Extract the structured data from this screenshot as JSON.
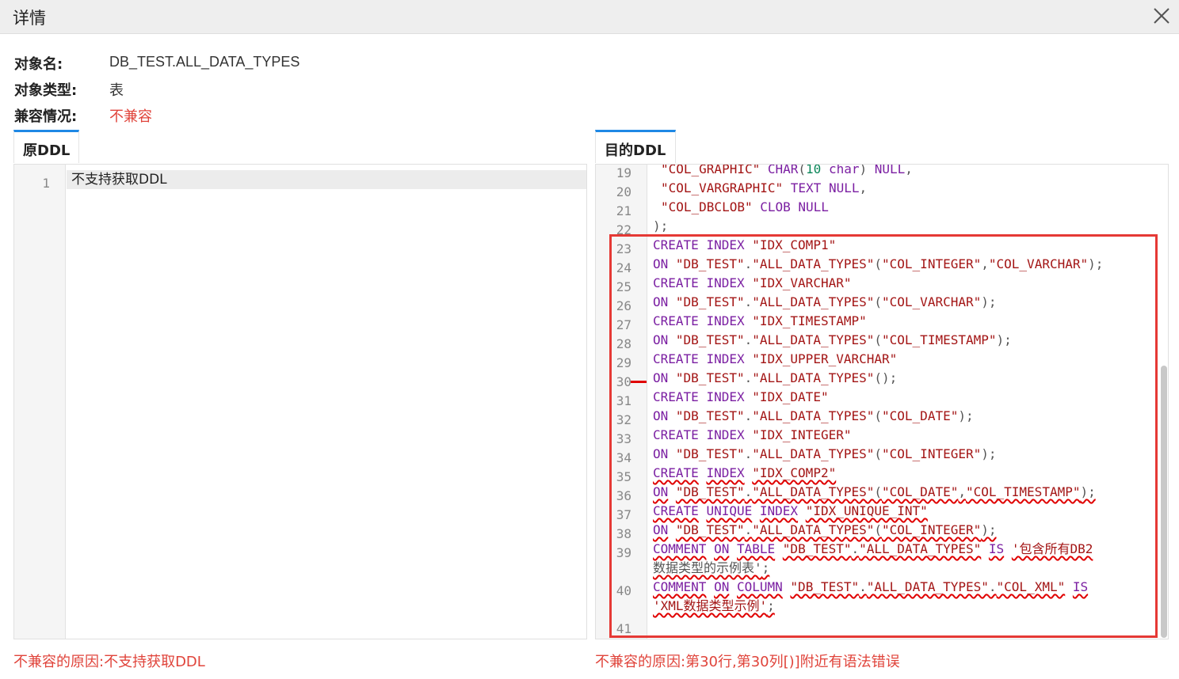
{
  "dialog": {
    "title": "详情"
  },
  "info": {
    "object_name_label": "对象名:",
    "object_name_value": "DB_TEST.ALL_DATA_TYPES",
    "object_type_label": "对象类型:",
    "object_type_value": "表",
    "compat_label": "兼容情况:",
    "compat_value": "不兼容"
  },
  "source_panel": {
    "tab_label": "原DDL",
    "lines": [
      {
        "num": "1",
        "text": "不支持获取DDL"
      }
    ],
    "error_message": "不兼容的原因:不支持获取DDL"
  },
  "target_panel": {
    "tab_label": "目的DDL",
    "line_numbers": [
      "19",
      "20",
      "21",
      "22",
      "23",
      "24",
      "25",
      "26",
      "27",
      "28",
      "29",
      "30",
      "31",
      "32",
      "33",
      "34",
      "35",
      "36",
      "37",
      "38",
      "39",
      "",
      "40",
      "",
      "41"
    ],
    "error_message": "不兼容的原因:第30行,第30列[)]附近有语法错误",
    "code": {
      "l19": [
        "\"COL_GRAPHIC\"",
        "CHAR",
        "(",
        "10",
        "char",
        ")",
        "NULL",
        ","
      ],
      "l20": [
        "\"COL_VARGRAPHIC\"",
        "TEXT",
        "NULL",
        ","
      ],
      "l21": [
        "\"COL_DBCLOB\"",
        "CLOB",
        "NULL"
      ],
      "l22": [
        ");"
      ],
      "l23": [
        "CREATE",
        "INDEX",
        "\"IDX_COMP1\""
      ],
      "l24": [
        "ON",
        "\"DB_TEST\"",
        ".",
        "\"ALL_DATA_TYPES\"",
        "(",
        "\"COL_INTEGER\"",
        ",",
        "\"COL_VARCHAR\"",
        ");"
      ],
      "l25": [
        "CREATE",
        "INDEX",
        "\"IDX_VARCHAR\""
      ],
      "l26": [
        "ON",
        "\"DB_TEST\"",
        ".",
        "\"ALL_DATA_TYPES\"",
        "(",
        "\"COL_VARCHAR\"",
        ");"
      ],
      "l27": [
        "CREATE",
        "INDEX",
        "\"IDX_TIMESTAMP\""
      ],
      "l28": [
        "ON",
        "\"DB_TEST\"",
        ".",
        "\"ALL_DATA_TYPES\"",
        "(",
        "\"COL_TIMESTAMP\"",
        ");"
      ],
      "l29": [
        "CREATE",
        "INDEX",
        "\"IDX_UPPER_VARCHAR\""
      ],
      "l30": [
        "ON",
        "\"DB_TEST\"",
        ".",
        "\"ALL_DATA_TYPES\"",
        "(",
        ");"
      ],
      "l31": [
        "CREATE",
        "INDEX",
        "\"IDX_DATE\""
      ],
      "l32": [
        "ON",
        "\"DB_TEST\"",
        ".",
        "\"ALL_DATA_TYPES\"",
        "(",
        "\"COL_DATE\"",
        ");"
      ],
      "l33": [
        "CREATE",
        "INDEX",
        "\"IDX_INTEGER\""
      ],
      "l34": [
        "ON",
        "\"DB_TEST\"",
        ".",
        "\"ALL_DATA_TYPES\"",
        "(",
        "\"COL_INTEGER\"",
        ");"
      ],
      "l35": [
        "CREATE",
        "INDEX",
        "\"IDX_COMP2\""
      ],
      "l36": [
        "ON",
        "\"DB_TEST\"",
        ".",
        "\"ALL_DATA_TYPES\"",
        "(",
        "\"COL_DATE\"",
        ",",
        "\"COL_TIMESTAMP\"",
        ");"
      ],
      "l37": [
        "CREATE",
        "UNIQUE",
        "INDEX",
        "\"IDX_UNIQUE_INT\""
      ],
      "l38": [
        "ON",
        "\"DB_TEST\"",
        ".",
        "\"ALL_DATA_TYPES\"",
        "(",
        "\"COL_INTEGER\"",
        ");"
      ],
      "l39a": [
        "COMMENT",
        "ON",
        "TABLE",
        "\"DB_TEST\"",
        ".",
        "\"ALL_DATA_TYPES\"",
        "IS",
        "'包含所有DB2"
      ],
      "l39b": [
        "数据类型的示例表'",
        ";"
      ],
      "l40a": [
        "COMMENT",
        "ON",
        "COLUMN",
        "\"DB_TEST\"",
        ".",
        "\"ALL_DATA_TYPES\"",
        ".",
        "\"COL_XML\"",
        "IS"
      ],
      "l40b": [
        "'XML数据类型示例'",
        ";"
      ]
    }
  },
  "colors": {
    "accent": "#1e88e5",
    "error": "#e0443b",
    "keyword": "#7b1fa2",
    "string": "#a31515",
    "number": "#098658"
  }
}
